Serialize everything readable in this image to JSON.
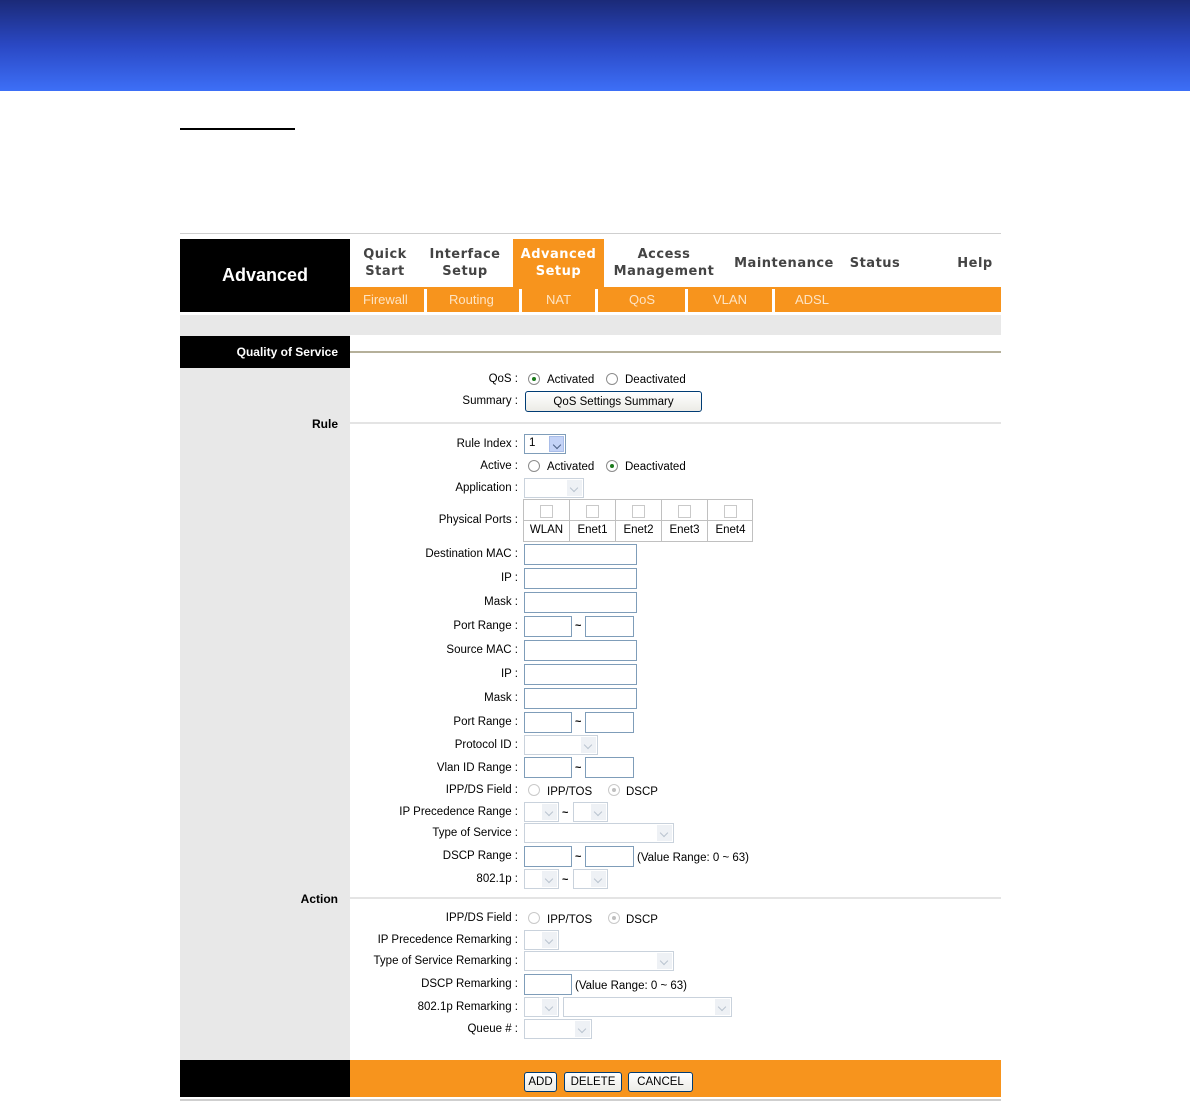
{
  "brand": "Advanced",
  "nav": [
    {
      "label": "Quick\nStart",
      "active": false
    },
    {
      "label": "Interface\nSetup",
      "active": false
    },
    {
      "label": "Advanced\nSetup",
      "active": true
    },
    {
      "label": "Access\nManagement",
      "active": false
    },
    {
      "label": "Maintenance",
      "active": false
    },
    {
      "label": "Status",
      "active": false
    },
    {
      "label": "Help",
      "active": false
    }
  ],
  "subnav": [
    "Firewall",
    "Routing",
    "NAT",
    "QoS",
    "VLAN",
    "ADSL"
  ],
  "section_title": "Quality of Service",
  "sub_rule": "Rule",
  "sub_action": "Action",
  "qos": {
    "label": "QoS :",
    "activated": "Activated",
    "deactivated": "Deactivated"
  },
  "summary": {
    "label": "Summary :",
    "button": "QoS Settings Summary"
  },
  "rule": {
    "rule_index_label": "Rule Index :",
    "rule_index_value": "1",
    "active_label": "Active :",
    "activated": "Activated",
    "deactivated": "Deactivated",
    "application_label": "Application :",
    "physical_ports_label": "Physical Ports :",
    "ports": [
      "WLAN",
      "Enet1",
      "Enet2",
      "Enet3",
      "Enet4"
    ],
    "dest_mac_label": "Destination MAC :",
    "ip_label": "IP :",
    "mask_label": "Mask :",
    "port_range_label": "Port Range :",
    "source_mac_label": "Source MAC :",
    "protocol_id_label": "Protocol ID :",
    "vlan_id_range_label": "Vlan ID Range :",
    "ippds_label": "IPP/DS Field :",
    "ipptos": "IPP/TOS",
    "dscp": "DSCP",
    "ip_precedence_range_label": "IP Precedence Range :",
    "type_of_service_label": "Type of Service :",
    "dscp_range_label": "DSCP Range :",
    "dscp_range_note": "(Value Range: 0 ~ 63)",
    "p8021_label": "802.1p :",
    "tilde": "~"
  },
  "action": {
    "ippds_label": "IPP/DS Field :",
    "ipptos": "IPP/TOS",
    "dscp": "DSCP",
    "ip_prec_remark_label": "IP Precedence Remarking :",
    "tos_remark_label": "Type of Service Remarking :",
    "dscp_remark_label": "DSCP Remarking :",
    "dscp_remark_note": "(Value Range: 0 ~ 63)",
    "p8021_remark_label": "802.1p Remarking :",
    "queue_label": "Queue # :"
  },
  "buttons": {
    "add": "ADD",
    "delete": "DELETE",
    "cancel": "CANCEL"
  }
}
